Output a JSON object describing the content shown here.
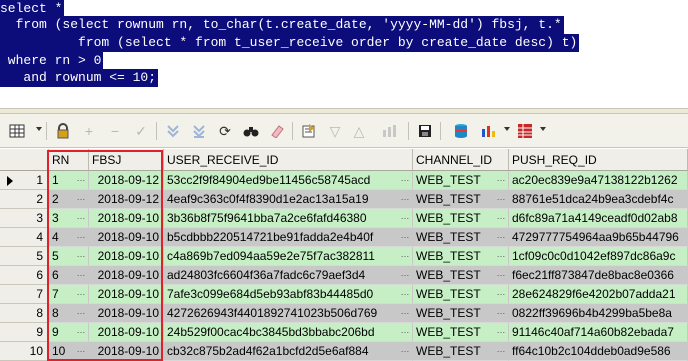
{
  "editor": {
    "lines": [
      "select *",
      "  from (select rownum rn, to_char(t.create_date, 'yyyy-MM-dd') fbsj, t.*",
      "          from (select * from t_user_receive order by create_date desc) t)",
      " where rn > 0",
      "   and rownum <= 10;"
    ]
  },
  "toolbar": {
    "icons": [
      "grid-menu-icon",
      "lock-icon",
      "add-row-icon",
      "delete-row-icon",
      "post-check-icon",
      "filter-down-icon",
      "filter-down-alt-icon",
      "refresh-icon",
      "find-binoculars-icon",
      "clear-eraser-icon",
      "export-query-icon",
      "sort-down-icon",
      "sort-up-icon",
      "chart-bars-disabled-icon",
      "save-disk-icon",
      "database-icon",
      "bar-chart-icon",
      "table-grid-icon"
    ]
  },
  "grid": {
    "columns": [
      "RN",
      "FBSJ",
      "USER_RECEIVE_ID",
      "CHANNEL_ID",
      "PUSH_REQ_ID"
    ],
    "rows": [
      {
        "n": "1",
        "rn": "1",
        "fbsj": "2018-09-12",
        "uid": "53cc2f9f84904ed9be11456c58745acd",
        "ch": "WEB_TEST",
        "push": "ac20ec839e9a47138122b1262"
      },
      {
        "n": "2",
        "rn": "2",
        "fbsj": "2018-09-12",
        "uid": "4eaf9c363c0f4f8390d1e2ac13a15a19",
        "ch": "WEB_TEST",
        "push": "88761e51dca24b9ea3cdebf4c"
      },
      {
        "n": "3",
        "rn": "3",
        "fbsj": "2018-09-10",
        "uid": "3b36b8f75f9641bba7a2ce6fafd46380",
        "ch": "WEB_TEST",
        "push": "d6fc89a71a4149ceadf0d02ab8"
      },
      {
        "n": "4",
        "rn": "4",
        "fbsj": "2018-09-10",
        "uid": "b5cdbbb220514721be91fadda2e4b40f",
        "ch": "WEB_TEST",
        "push": "4729777754964aa9b65b44796"
      },
      {
        "n": "5",
        "rn": "5",
        "fbsj": "2018-09-10",
        "uid": "c4a869b7ed094aa59e2e75f7ac382811",
        "ch": "WEB_TEST",
        "push": "1cf09c0c0d1042ef897dc86a9c"
      },
      {
        "n": "6",
        "rn": "6",
        "fbsj": "2018-09-10",
        "uid": "ad24803fc6604f36a7fadc6c79aef3d4",
        "ch": "WEB_TEST",
        "push": "f6ec21ff873847de8bac8e0366"
      },
      {
        "n": "7",
        "rn": "7",
        "fbsj": "2018-09-10",
        "uid": "7afe3c099e684d5eb93abf83b44485d0",
        "ch": "WEB_TEST",
        "push": "28e624829f6e4202b07adda21"
      },
      {
        "n": "8",
        "rn": "8",
        "fbsj": "2018-09-10",
        "uid": "4272626943f4401892741023b506d769",
        "ch": "WEB_TEST",
        "push": "0822ff39696b4b4299ba5be8a"
      },
      {
        "n": "9",
        "rn": "9",
        "fbsj": "2018-09-10",
        "uid": "24b529f00cac4bc3845bd3bbabc206bd",
        "ch": "WEB_TEST",
        "push": "91146c40af714a60b82ebada7"
      },
      {
        "n": "10",
        "rn": "10",
        "fbsj": "2018-09-10",
        "uid": "cb32c875b2ad4f62a1bcfd2d5e6af884",
        "ch": "WEB_TEST",
        "push": "ff64c10b2c104ddeb0ad9e586"
      }
    ],
    "row_colors": [
      "green",
      "gray"
    ]
  },
  "colors": {
    "selection": "#0c0c7a",
    "highlight_box": "#e0202a",
    "green_row": "#c6efc6",
    "gray_row": "#c8c8c8"
  }
}
